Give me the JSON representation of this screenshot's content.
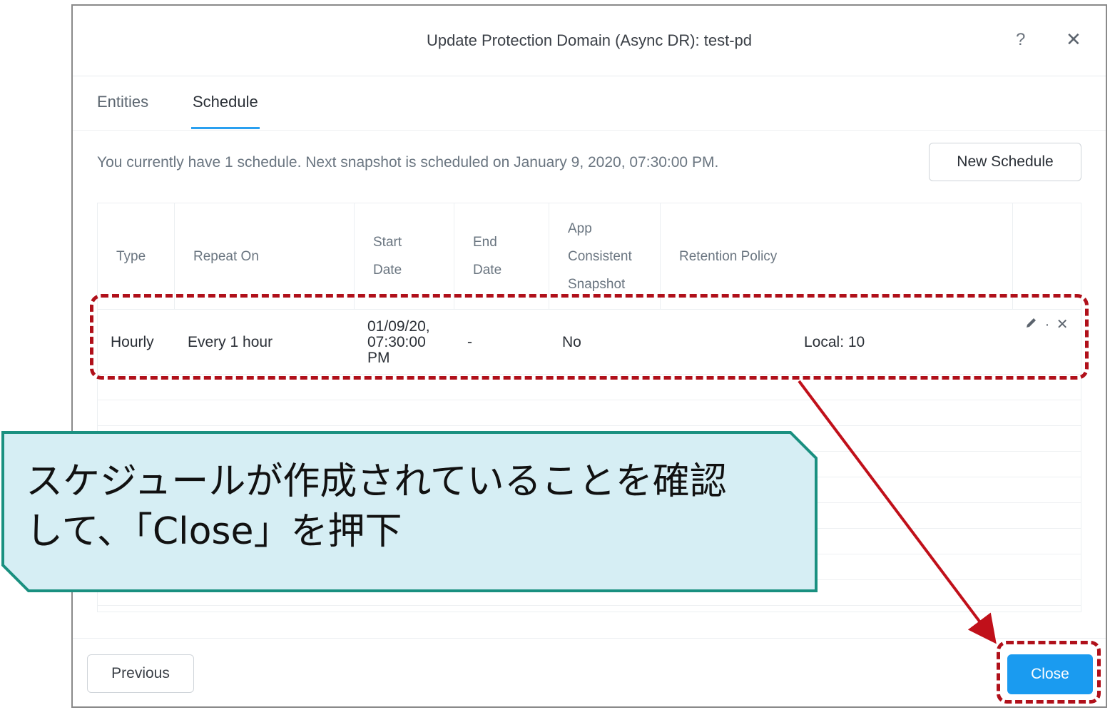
{
  "dialog": {
    "title": "Update Protection Domain (Async DR): test-pd",
    "help_glyph": "?",
    "close_glyph": "✕"
  },
  "tabs": [
    {
      "label": "Entities",
      "active": false
    },
    {
      "label": "Schedule",
      "active": true
    }
  ],
  "summary_text": "You currently have 1 schedule. Next snapshot is scheduled on January 9, 2020, 07:30:00 PM.",
  "new_schedule_label": "New Schedule",
  "table": {
    "headers": {
      "type": "Type",
      "repeat_on": "Repeat On",
      "start_date_1": "Start",
      "start_date_2": "Date",
      "end_date_1": "End",
      "end_date_2": "Date",
      "app_1": "App",
      "app_2": "Consistent",
      "app_3": "Snapshot",
      "retention": "Retention Policy"
    },
    "rows": [
      {
        "type": "Hourly",
        "repeat_on": "Every 1 hour",
        "start_date_1": "01/09/20,",
        "start_date_2": "07:30:00",
        "start_date_3": "PM",
        "end_date": "-",
        "app_consistent": "No",
        "retention": "Local: 10"
      }
    ],
    "row_action_separator": "·",
    "row_delete_glyph": "✕"
  },
  "footer": {
    "previous_label": "Previous",
    "close_label": "Close"
  },
  "annotation": {
    "line1": "スケジュールが作成されていることを確認",
    "line2": "して、「Close」を押下",
    "highlight_color": "#b0101a",
    "callout_fill": "#d6eef4",
    "callout_border": "#1a9080"
  },
  "colors": {
    "accent": "#1a9bf0",
    "tab_underline": "#2aa0f0"
  }
}
